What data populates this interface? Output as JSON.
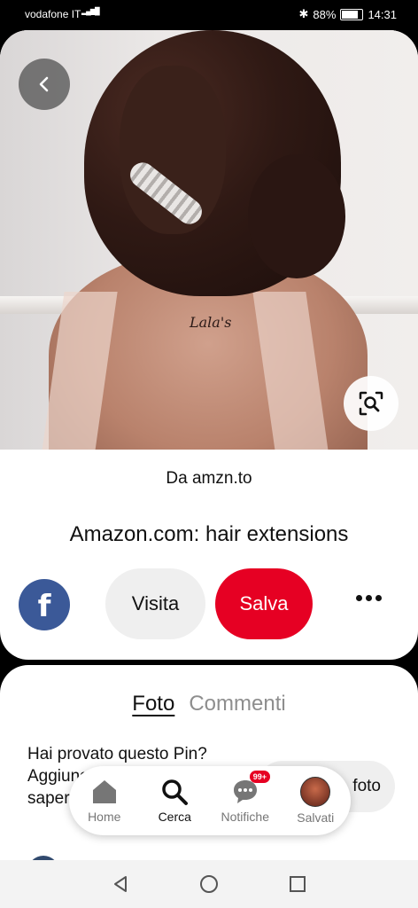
{
  "status_bar": {
    "carrier": "vodafone IT",
    "network": "4G",
    "battery": "88%",
    "time": "14:31"
  },
  "pin": {
    "source_prefix": "Da",
    "source_domain": "amzn.to",
    "title": "Amazon.com: hair extensions",
    "photo_text": "Lala's"
  },
  "actions": {
    "share_icon": "facebook-icon",
    "visit_label": "Visita",
    "save_label": "Salva",
    "more_icon": "more-dots-icon"
  },
  "tabs": [
    {
      "label": "Foto",
      "active": true
    },
    {
      "label": "Commenti",
      "active": false
    }
  ],
  "tried": {
    "text": "Hai provato questo Pin? Aggiungi una foto per farci sapere com'è andata",
    "button_label": "foto"
  },
  "bottom_nav": [
    {
      "label": "Home",
      "icon": "home-icon"
    },
    {
      "label": "Cerca",
      "icon": "search-icon",
      "active": true
    },
    {
      "label": "Notifiche",
      "icon": "chat-icon",
      "badge": "99+"
    },
    {
      "label": "Salvati",
      "icon": "avatar"
    }
  ],
  "colors": {
    "brand_red": "#e60023",
    "facebook_blue": "#3b5998"
  }
}
